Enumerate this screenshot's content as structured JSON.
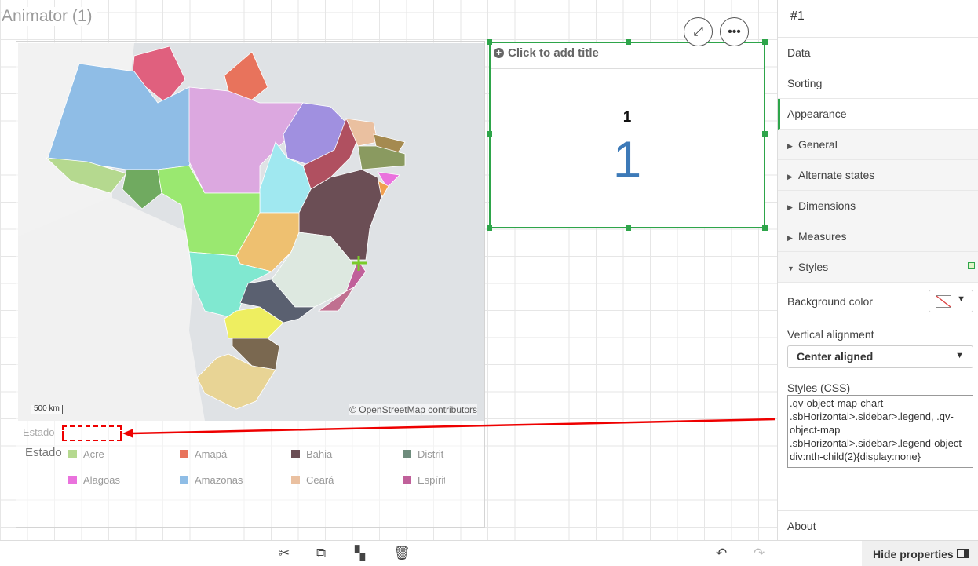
{
  "sheet": {
    "title": "Animator (1)"
  },
  "map": {
    "scale_label": "500 km",
    "attribution": "© OpenStreetMap contributors",
    "legend_header": "Estado",
    "legend_title": "Estado",
    "legend_items": [
      {
        "label": "Acre",
        "color": "#b5d98f"
      },
      {
        "label": "Alagoas",
        "color": "#ea72dd"
      },
      {
        "label": "Amapá",
        "color": "#e8735c"
      },
      {
        "label": "Amazonas",
        "color": "#8fbde6"
      },
      {
        "label": "Bahia",
        "color": "#6b4e55"
      },
      {
        "label": "Ceará",
        "color": "#eac0a0"
      },
      {
        "label": "Distrit",
        "color": "#6e8c7c"
      },
      {
        "label": "Espírit",
        "color": "#c0609a"
      }
    ]
  },
  "textbox": {
    "title_placeholder": "Click to add title",
    "kpi_label": "1",
    "kpi_value": "1",
    "expand_icon": "expand-icon",
    "more_icon": "more-icon"
  },
  "panel": {
    "header": "#1",
    "tabs": [
      "Data",
      "Sorting",
      "Appearance"
    ],
    "sections": [
      "General",
      "Alternate states",
      "Dimensions",
      "Measures",
      "Styles"
    ],
    "styles": {
      "background_color_label": "Background color",
      "vertical_alignment_label": "Vertical alignment",
      "vertical_alignment_value": "Center aligned",
      "css_label": "Styles (CSS)",
      "css_value": ".qv-object-map-chart .sbHorizontal>.sidebar>.legend, .qv-object-map .sbHorizontal>.sidebar>.legend-object div:nth-child(2){display:none}"
    },
    "about": "About"
  },
  "toolbar": {
    "hide_properties": "Hide properties"
  },
  "colors": {
    "accent": "#2ea54a",
    "kpi": "#3d7ab8",
    "annotation": "#e00000"
  }
}
